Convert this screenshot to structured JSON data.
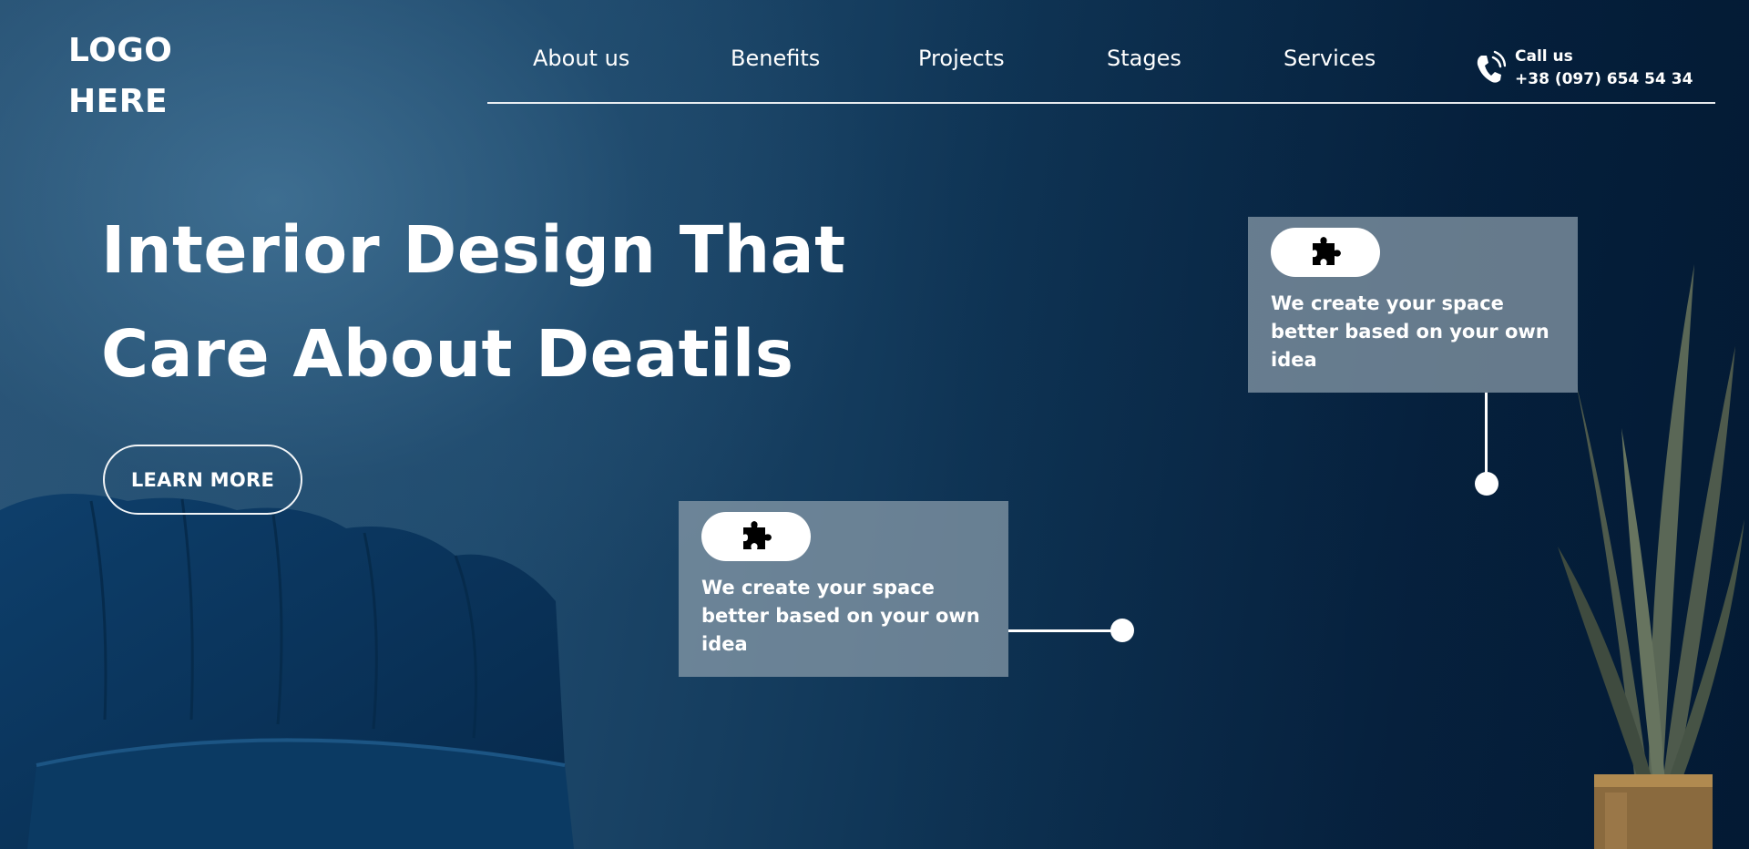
{
  "logo": {
    "line1": "LOGO",
    "line2": "HERE"
  },
  "nav": {
    "items": [
      {
        "label": "About us"
      },
      {
        "label": "Benefits"
      },
      {
        "label": "Projects"
      },
      {
        "label": "Stages"
      },
      {
        "label": "Services"
      }
    ]
  },
  "contact": {
    "title": "Call us",
    "phone": "+38 (097) 654 54 34",
    "icon": "phone-icon"
  },
  "hero": {
    "title_line1": "Interior Design That",
    "title_line2": "Care About Deatils",
    "cta_label": "LEARN MORE"
  },
  "cards": [
    {
      "icon": "puzzle-icon",
      "text": "We create your space better based on your own idea"
    },
    {
      "icon": "puzzle-icon",
      "text": "We create your space better based on your own idea"
    }
  ],
  "colors": {
    "background_dark": "#05203d",
    "background_light": "#2c5678",
    "card_background": "#8c9eac",
    "accent": "#ffffff"
  }
}
